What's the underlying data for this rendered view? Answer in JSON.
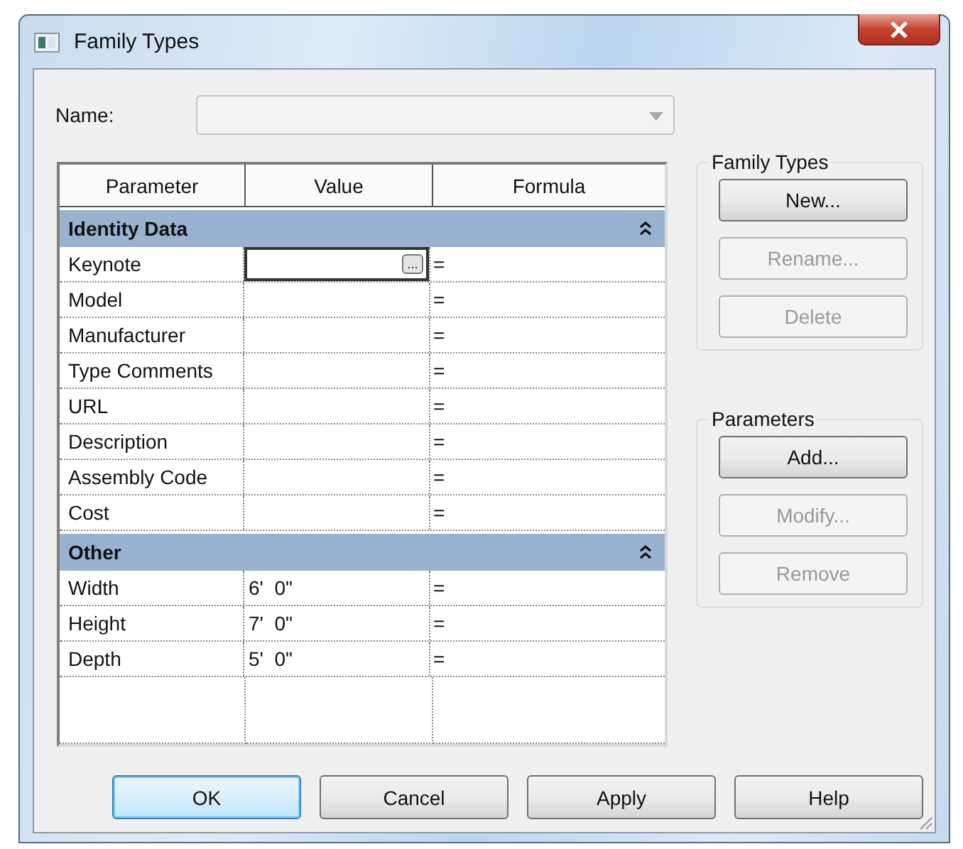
{
  "window": {
    "title": "Family Types"
  },
  "name_field": {
    "label": "Name:",
    "disabled": true
  },
  "table": {
    "columns": [
      "Parameter",
      "Value",
      "Formula"
    ],
    "browse_label": "...",
    "groups": [
      {
        "name": "Identity Data",
        "expanded": true,
        "rows": [
          {
            "parameter": "Keynote",
            "formula": "=",
            "selected": true
          },
          {
            "parameter": "Model",
            "formula": "=",
            "selected": false
          },
          {
            "parameter": "Manufacturer",
            "formula": "=",
            "selected": false
          },
          {
            "parameter": "Type Comments",
            "formula": "=",
            "selected": false
          },
          {
            "parameter": "URL",
            "formula": "=",
            "selected": false
          },
          {
            "parameter": "Description",
            "formula": "=",
            "selected": false
          },
          {
            "parameter": "Assembly Code",
            "formula": "=",
            "selected": false
          },
          {
            "parameter": "Cost",
            "formula": "=",
            "selected": false
          }
        ]
      },
      {
        "name": "Other",
        "expanded": true,
        "rows": [
          {
            "parameter": "Width",
            "value": "6'  0\"",
            "formula": "=",
            "selected": false
          },
          {
            "parameter": "Height",
            "value": "7'  0\"",
            "formula": "=",
            "selected": false
          },
          {
            "parameter": "Depth",
            "value": "5'  0\"",
            "formula": "=",
            "selected": false
          }
        ]
      }
    ]
  },
  "side_groups": [
    {
      "title": "Family Types",
      "buttons": [
        {
          "label": "New...",
          "disabled": false
        },
        {
          "label": "Rename...",
          "disabled": true
        },
        {
          "label": "Delete",
          "disabled": true
        }
      ]
    },
    {
      "title": "Parameters",
      "buttons": [
        {
          "label": "Add...",
          "disabled": false
        },
        {
          "label": "Modify...",
          "disabled": true
        },
        {
          "label": "Remove",
          "disabled": true
        }
      ]
    }
  ],
  "buttons": [
    {
      "label": "OK",
      "default": true
    },
    {
      "label": "Cancel",
      "default": false
    },
    {
      "label": "Apply",
      "default": false
    },
    {
      "label": "Help",
      "default": false
    }
  ]
}
